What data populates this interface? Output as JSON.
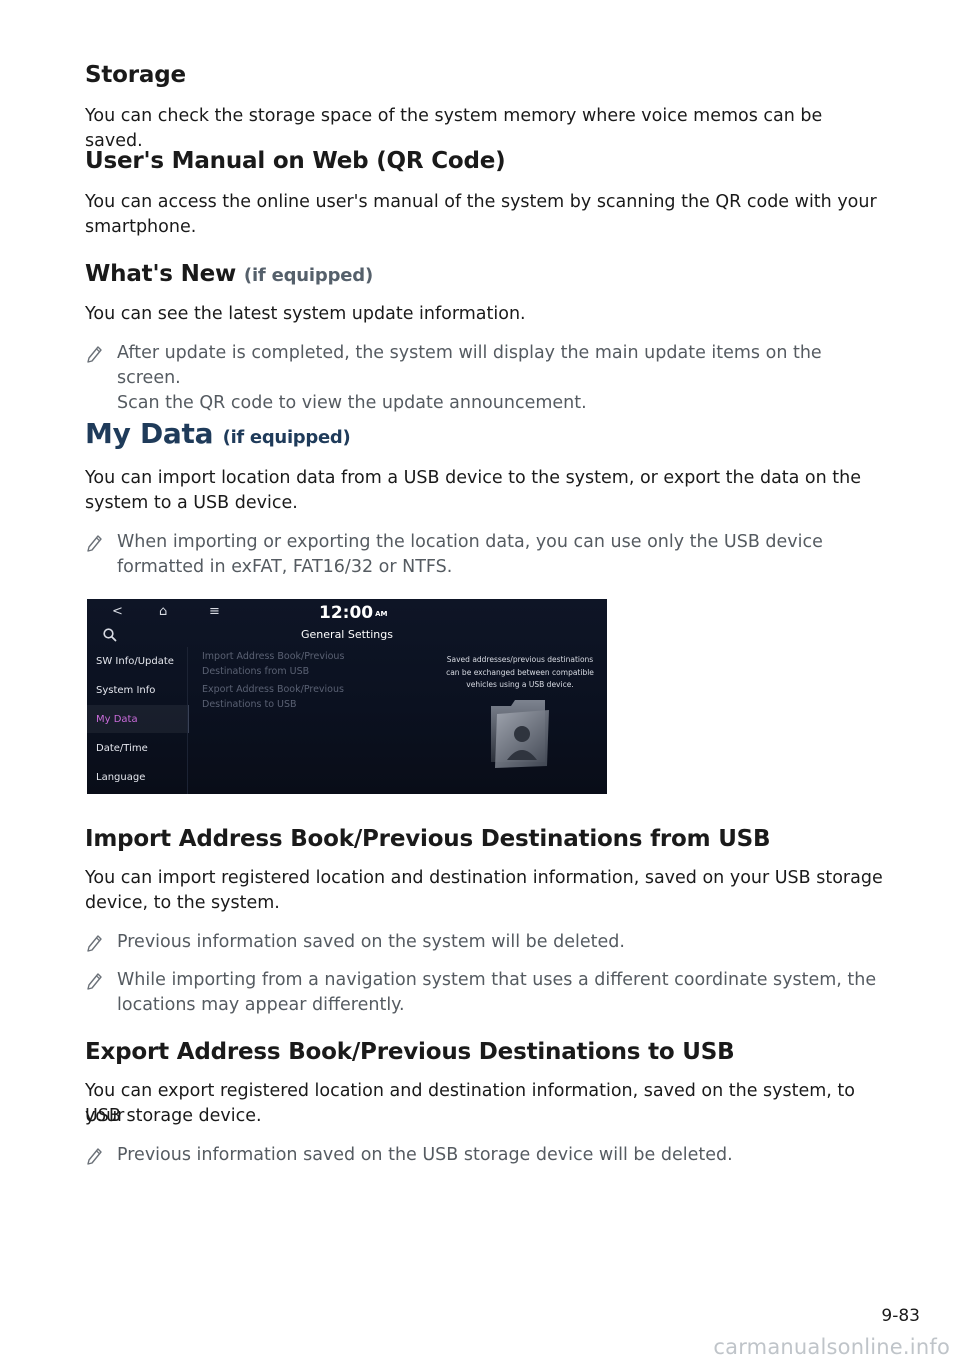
{
  "storage": {
    "heading": "Storage",
    "body": "You can check the storage space of the system memory where voice memos can be saved."
  },
  "manual_web": {
    "heading": "User's Manual on Web (QR Code)",
    "body_l1": "You can access the online user's manual of the system by scanning the QR code with your",
    "body_l2": "smartphone."
  },
  "whats_new": {
    "heading": "What's New",
    "optional": "(if equipped)",
    "body": "You can see the latest system update information.",
    "note_l1": "After update is completed, the system will display the main update items on the screen.",
    "note_l2": "Scan the QR code to view the update announcement."
  },
  "my_data": {
    "heading": "My Data",
    "optional": "(if equipped)",
    "body_l1": "You can import location data from a USB device to the system, or export the data on the",
    "body_l2": "system to a USB device.",
    "note_l1": "When importing or exporting the location data, you can use only the USB device",
    "note_l2": "formatted in exFAT, FAT16/32 or NTFS."
  },
  "screen": {
    "back_icon": "<",
    "home_icon": "⌂",
    "menu_icon": "≡",
    "time": "12:00",
    "ampm": "AM",
    "title": "General Settings",
    "sidebar": [
      "SW Info/Update",
      "System Info",
      "My Data",
      "Date/Time",
      "Language"
    ],
    "menu": [
      "Import Address Book/Previous",
      "Destinations from USB",
      "Export Address Book/Previous",
      "Destinations to USB"
    ],
    "info_l1": "Saved addresses/previous destinations",
    "info_l2": "can be exchanged between compatible",
    "info_l3": "vehicles using a USB device.",
    "accent_color": "#c96bd9"
  },
  "import_usb": {
    "heading": "Import Address Book/Previous Destinations from USB",
    "body_l1": "You can import registered location and destination information, saved on your USB storage",
    "body_l2": "device, to the system.",
    "note1": "Previous information saved on the system will be deleted.",
    "note2_l1": "While importing from a navigation system that uses a different coordinate system, the",
    "note2_l2": "locations may appear differently."
  },
  "export_usb": {
    "heading": "Export Address Book/Previous Destinations to USB",
    "body_l1": "You can export registered location and destination information, saved on the system, to your",
    "body_l2": "USB storage device.",
    "note1": "Previous information saved on the USB storage device will be deleted."
  },
  "footer": {
    "page_number": "9-83",
    "watermark": "carmanualsonline.info"
  }
}
